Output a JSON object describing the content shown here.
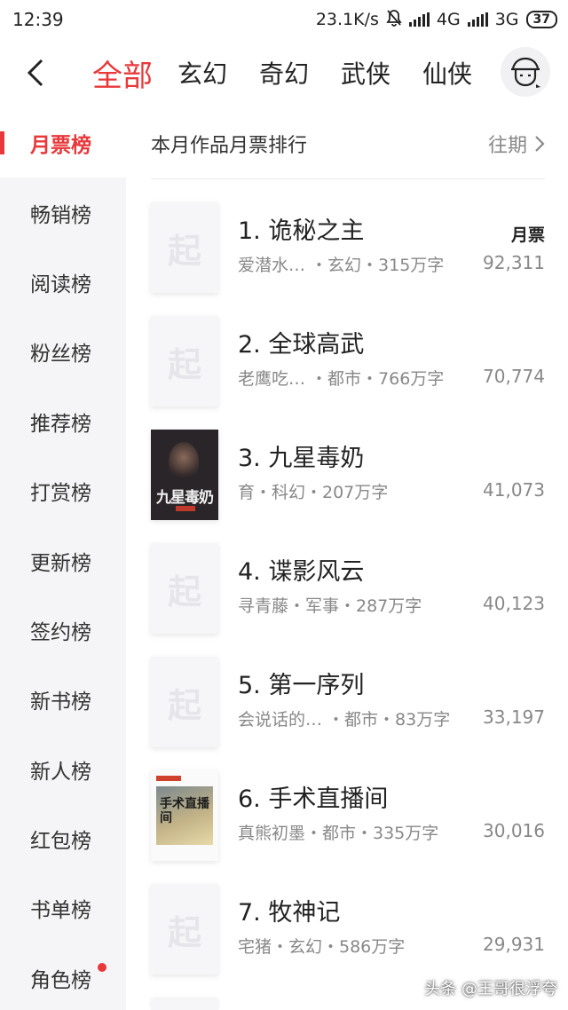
{
  "status_bar": {
    "time": "12:39",
    "speed": "23.1K/s",
    "net1": "4G",
    "net2": "3G",
    "battery": "37"
  },
  "nav": {
    "tabs": [
      "全部",
      "玄幻",
      "奇幻",
      "武侠",
      "仙侠"
    ],
    "active_tab": "全部"
  },
  "sidebar": {
    "items": [
      {
        "label": "月票榜"
      },
      {
        "label": "畅销榜"
      },
      {
        "label": "阅读榜"
      },
      {
        "label": "粉丝榜"
      },
      {
        "label": "推荐榜"
      },
      {
        "label": "打赏榜"
      },
      {
        "label": "更新榜"
      },
      {
        "label": "签约榜"
      },
      {
        "label": "新书榜"
      },
      {
        "label": "新人榜"
      },
      {
        "label": "红包榜"
      },
      {
        "label": "书单榜"
      },
      {
        "label": "角色榜"
      }
    ],
    "active": "月票榜"
  },
  "ranking": {
    "title": "本月作品月票排行",
    "history_label": "往期",
    "votes_label": "月票",
    "books": [
      {
        "title": "1. 诡秘之主",
        "meta": "爱潜水…  ・玄幻・315万字",
        "votes": "92,311",
        "cover": "placeholder"
      },
      {
        "title": "2. 全球高武",
        "meta": "老鹰吃…  ・都市・766万字",
        "votes": "70,774",
        "cover": "placeholder"
      },
      {
        "title": "3. 九星毒奶",
        "meta": "育・科幻・207万字",
        "votes": "41,073",
        "cover": "dark",
        "cover_text": "九星毒奶"
      },
      {
        "title": "4. 谍影风云",
        "meta": "寻青藤・军事・287万字",
        "votes": "40,123",
        "cover": "placeholder"
      },
      {
        "title": "5. 第一序列",
        "meta": "会说话的…  ・都市・83万字",
        "votes": "33,197",
        "cover": "placeholder"
      },
      {
        "title": "6. 手术直播间",
        "meta": "真熊初墨・都市・335万字",
        "votes": "30,016",
        "cover": "light",
        "cover_text": "手术直播间"
      },
      {
        "title": "7. 牧神记",
        "meta": "宅猪・玄幻・586万字",
        "votes": "29,931",
        "cover": "placeholder"
      }
    ],
    "placeholder_glyph": "起"
  },
  "watermark": "头条 @王哥很浮夸",
  "colors": {
    "accent": "#e8383b",
    "sidebar_bg": "#f5f5f7",
    "muted_text": "#888888"
  }
}
